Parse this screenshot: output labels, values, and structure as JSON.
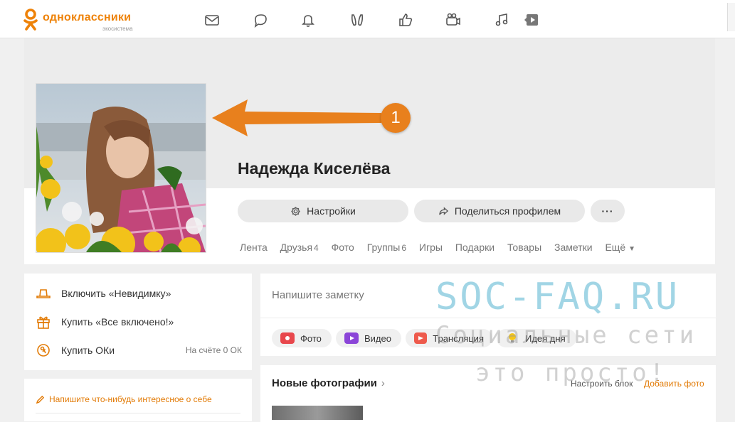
{
  "header": {
    "logo_text": "одноклассники",
    "logo_sub": "экосистема",
    "nav_icons": [
      "mail-icon",
      "chat-icon",
      "bell-icon",
      "guests-icon",
      "likes-icon",
      "video-camera-icon",
      "music-icon",
      "video-play-icon"
    ]
  },
  "annotation": {
    "badge_number": "1"
  },
  "profile": {
    "name": "Надежда Киселёва",
    "settings_label": "Настройки",
    "share_label": "Поделиться профилем",
    "more_label": "···"
  },
  "tabs": [
    {
      "label": "Лента",
      "count": ""
    },
    {
      "label": "Друзья",
      "count": "4"
    },
    {
      "label": "Фото",
      "count": ""
    },
    {
      "label": "Группы",
      "count": "6"
    },
    {
      "label": "Игры",
      "count": ""
    },
    {
      "label": "Подарки",
      "count": ""
    },
    {
      "label": "Товары",
      "count": ""
    },
    {
      "label": "Заметки",
      "count": ""
    },
    {
      "label": "Ещё",
      "count": ""
    }
  ],
  "left_menu": {
    "invisible_label": "Включить «Невидимку»",
    "all_inclusive_label": "Купить «Все включено!»",
    "buy_ok_label": "Купить ОКи",
    "balance_label": "На счёте 0 ОК"
  },
  "about": {
    "link_label": "Напишите что-нибудь интересное о себе"
  },
  "note": {
    "placeholder": "Напишите заметку",
    "actions": [
      "Фото",
      "Видео",
      "Трансляция",
      "Идея дня"
    ]
  },
  "photos": {
    "title": "Новые фотографии",
    "setup_label": "Настроить блок",
    "add_label": "Добавить фото"
  },
  "watermark": {
    "main": "SOC-FAQ.RU",
    "line1": "Социальные сети",
    "line2": "это просто!"
  },
  "colors": {
    "accent": "#ee8208",
    "arrow": "#e8801d",
    "watermark": "#7ec6dc"
  }
}
